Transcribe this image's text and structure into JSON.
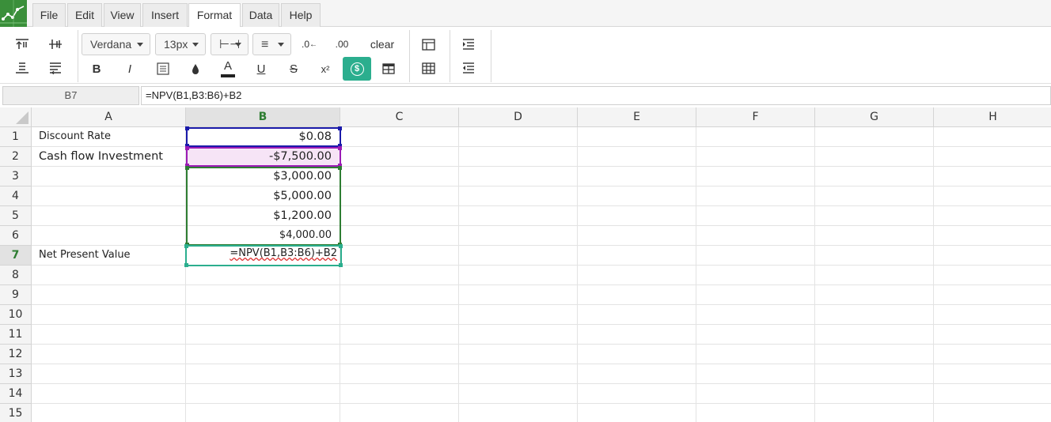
{
  "menu": [
    "File",
    "Edit",
    "View",
    "Insert",
    "Format",
    "Data",
    "Help"
  ],
  "menu_active": "Format",
  "toolbar": {
    "font": "Verdana",
    "font_size": "13px",
    "clear_label": "clear",
    "decrease_decimal_label": ".0",
    "increase_decimal_label": ".00",
    "bold_label": "B",
    "italic_label": "I",
    "font_color_label": "A",
    "underline_label": "U",
    "strike_label": "S",
    "superscript_label": "x²",
    "currency_label": "$"
  },
  "formula_bar": {
    "name_box": "B7",
    "formula": "=NPV(B1,B3:B6)+B2"
  },
  "columns": [
    "A",
    "B",
    "C",
    "D",
    "E",
    "F",
    "G",
    "H"
  ],
  "selected_column": "B",
  "selected_row": "7",
  "rows": [
    {
      "num": "1",
      "a": "Discount Rate",
      "b": "$0.08"
    },
    {
      "num": "2",
      "a": "Cash flow Investment",
      "b": "-$7,500.00"
    },
    {
      "num": "3",
      "a": "",
      "b": "$3,000.00"
    },
    {
      "num": "4",
      "a": "",
      "b": "$5,000.00"
    },
    {
      "num": "5",
      "a": "",
      "b": "$1,200.00"
    },
    {
      "num": "6",
      "a": "",
      "b": "$4,000.00"
    },
    {
      "num": "7",
      "a": "Net Present Value",
      "b": "=NPV(B1,B3:B6)+B2"
    },
    {
      "num": "8",
      "a": "",
      "b": ""
    },
    {
      "num": "9",
      "a": "",
      "b": ""
    },
    {
      "num": "10",
      "a": "",
      "b": ""
    },
    {
      "num": "11",
      "a": "",
      "b": ""
    },
    {
      "num": "12",
      "a": "",
      "b": ""
    },
    {
      "num": "13",
      "a": "",
      "b": ""
    },
    {
      "num": "14",
      "a": "",
      "b": ""
    },
    {
      "num": "15",
      "a": "",
      "b": ""
    }
  ],
  "colors": {
    "accent": "#2bae8e",
    "ref_blue": "#1a1aaa",
    "ref_purple": "#9b1bb5",
    "ref_green": "#2e7d32",
    "edit_border": "#2bae8e",
    "pink_fill": "#f6e4f6"
  }
}
